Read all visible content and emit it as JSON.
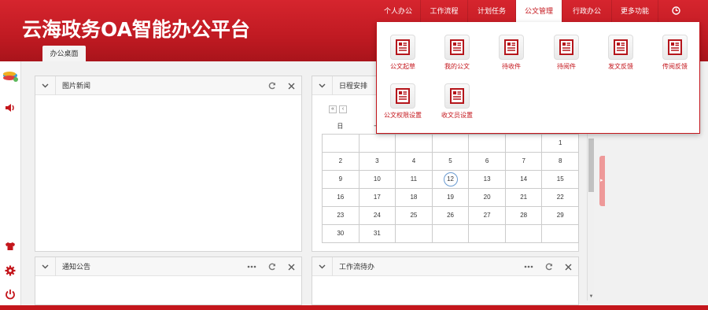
{
  "app": {
    "title": "云海政务OA智能办公平台",
    "desk_tab": "办公桌面",
    "accent": "#c4161c"
  },
  "topnav": [
    {
      "label": "个人办公",
      "name": "nav-personal-office",
      "width": 56
    },
    {
      "label": "工作流程",
      "name": "nav-workflow",
      "width": 59
    },
    {
      "label": "计划任务",
      "name": "nav-plan-tasks",
      "width": 60
    },
    {
      "label": "公文管理",
      "name": "nav-document-management",
      "width": 58,
      "active": true
    },
    {
      "label": "行政办公",
      "name": "nav-admin-office",
      "width": 62
    },
    {
      "label": "更多功能",
      "name": "nav-more-functions",
      "width": 58
    }
  ],
  "dropdown": {
    "items": [
      {
        "label": "公文起草",
        "name": "menu-item-document-draft"
      },
      {
        "label": "我的公文",
        "name": "menu-item-my-documents"
      },
      {
        "label": "待收件",
        "name": "menu-item-pending-receive"
      },
      {
        "label": "待阅件",
        "name": "menu-item-pending-read"
      },
      {
        "label": "发文反馈",
        "name": "menu-item-send-feedback"
      },
      {
        "label": "传阅反馈",
        "name": "menu-item-circulate-feedback"
      },
      {
        "label": "公文权限设置",
        "name": "menu-item-document-permissions"
      },
      {
        "label": "收文员设置",
        "name": "menu-item-receiver-settings"
      }
    ]
  },
  "panels": {
    "photo_news": {
      "title": "图片新闻"
    },
    "schedule": {
      "title": "日程安排"
    },
    "notice": {
      "title": "通知公告"
    },
    "workflow_todo": {
      "title": "工作流待办"
    }
  },
  "calendar": {
    "nav_prev_year": "«",
    "nav_prev_month": "‹",
    "weekdays": [
      "日",
      "一",
      "",
      "",
      "",
      "",
      "",
      ""
    ],
    "rows": [
      [
        "",
        "",
        "",
        "",
        "",
        "",
        "1"
      ],
      [
        "2",
        "3",
        "4",
        "5",
        "6",
        "7",
        "8"
      ],
      [
        "9",
        "10",
        "11",
        "12",
        "13",
        "14",
        "15"
      ],
      [
        "16",
        "17",
        "18",
        "19",
        "20",
        "21",
        "22"
      ],
      [
        "23",
        "24",
        "25",
        "26",
        "27",
        "28",
        "29"
      ],
      [
        "30",
        "31",
        "",
        "",
        "",
        "",
        ""
      ]
    ],
    "today": "12"
  }
}
